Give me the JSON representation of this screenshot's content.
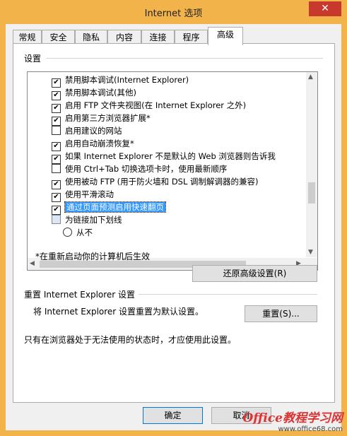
{
  "window": {
    "title": "Internet 选项",
    "close_glyph": "✕"
  },
  "tabs": [
    "常规",
    "安全",
    "隐私",
    "内容",
    "连接",
    "程序",
    "高级"
  ],
  "active_tab": "高级",
  "settings": {
    "group_label": "设置",
    "items": [
      {
        "type": "checkbox",
        "checked": true,
        "label": "禁用脚本调试(Internet Explorer)"
      },
      {
        "type": "checkbox",
        "checked": true,
        "label": "禁用脚本调试(其他)"
      },
      {
        "type": "checkbox",
        "checked": true,
        "label": "启用 FTP 文件夹视图(在 Internet Explorer 之外)"
      },
      {
        "type": "checkbox",
        "checked": true,
        "label": "启用第三方浏览器扩展*"
      },
      {
        "type": "checkbox",
        "checked": false,
        "label": "启用建议的网站"
      },
      {
        "type": "checkbox",
        "checked": true,
        "label": "启用自动崩溃恢复*"
      },
      {
        "type": "checkbox",
        "checked": true,
        "label": "如果 Internet Explorer 不是默认的 Web 浏览器则告诉我"
      },
      {
        "type": "checkbox",
        "checked": false,
        "label": "使用 Ctrl+Tab 切换选项卡时，使用最新顺序"
      },
      {
        "type": "checkbox",
        "checked": true,
        "label": "使用被动 FTP (用于防火墙和 DSL 调制解调器的兼容)"
      },
      {
        "type": "checkbox",
        "checked": true,
        "label": "使用平滑滚动"
      },
      {
        "type": "checkbox",
        "checked": true,
        "label": "通过页面预测启用快速翻页",
        "selected": true
      },
      {
        "type": "group",
        "label": "为链接加下划线"
      },
      {
        "type": "radio",
        "checked": false,
        "label": "从不"
      }
    ],
    "restart_note": "*在重新启动你的计算机后生效",
    "restore_button": "还原高级设置(R)"
  },
  "reset": {
    "group_label": "重置 Internet Explorer 设置",
    "description": "将 Internet Explorer 设置重置为默认设置。",
    "button": "重置(S)...",
    "note": "只有在浏览器处于无法使用的状态时，才应使用此设置。"
  },
  "footer": {
    "ok": "确定",
    "cancel": "取消"
  },
  "watermark": {
    "logo": "Office教程学习网",
    "url": "www.office68.com"
  },
  "colors": {
    "accent_window": "#f2b44a",
    "close": "#c7392c",
    "selection": "#3399ff"
  }
}
